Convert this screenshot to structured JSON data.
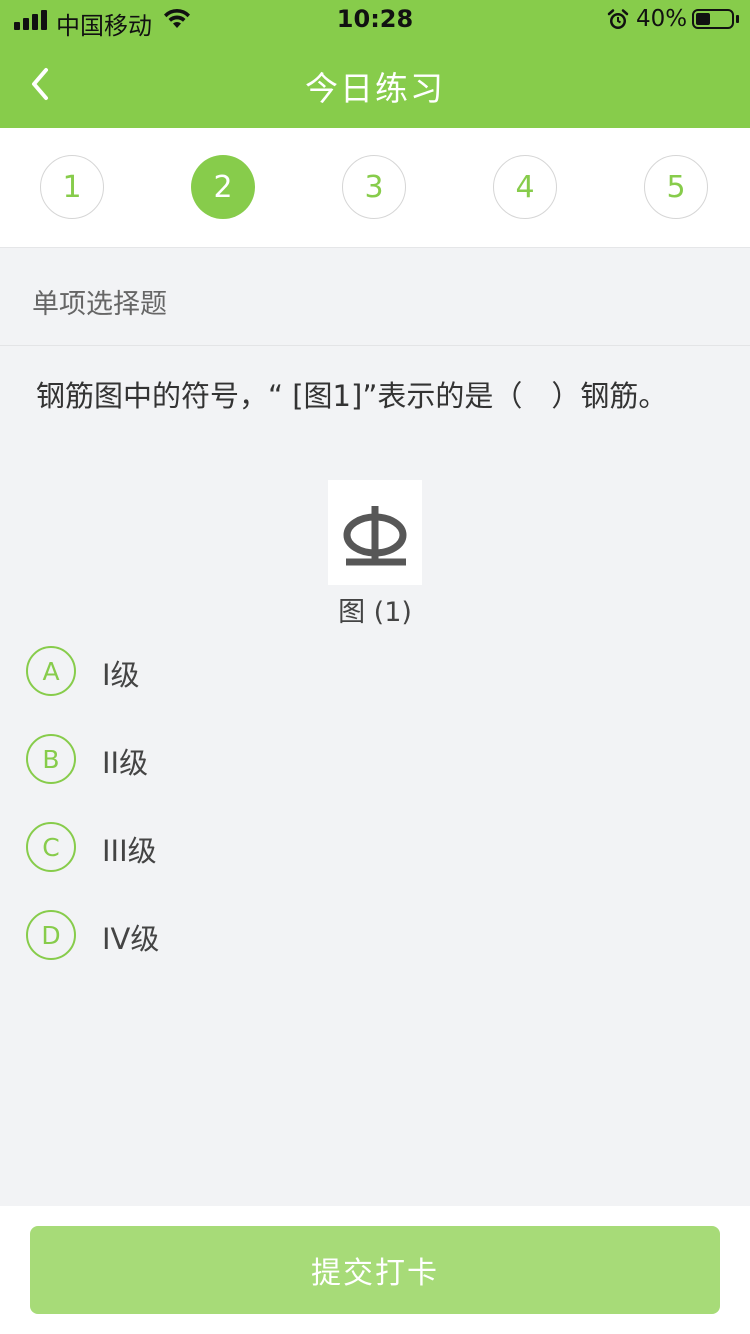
{
  "status_bar": {
    "carrier": "中国移动",
    "time": "10:28",
    "battery": "40%",
    "battery_level": 0.4
  },
  "nav": {
    "title": "今日练习",
    "back_icon": "chevron-left-icon"
  },
  "steps": {
    "items": [
      "1",
      "2",
      "3",
      "4",
      "5"
    ],
    "active_index": 1
  },
  "question": {
    "type": "单项选择题",
    "text": "钢筋图中的符号，“ [图1]”表示的是（　）钢筋。",
    "figure_caption": "图 (1)",
    "figure_symbol": "Φ"
  },
  "options": [
    {
      "letter": "A",
      "text": "I级"
    },
    {
      "letter": "B",
      "text": "II级"
    },
    {
      "letter": "C",
      "text": "III级"
    },
    {
      "letter": "D",
      "text": "IV级"
    }
  ],
  "footer": {
    "submit_label": "提交打卡"
  },
  "colors": {
    "brand": "#87cc4b",
    "submit_disabled": "#a7db78"
  }
}
